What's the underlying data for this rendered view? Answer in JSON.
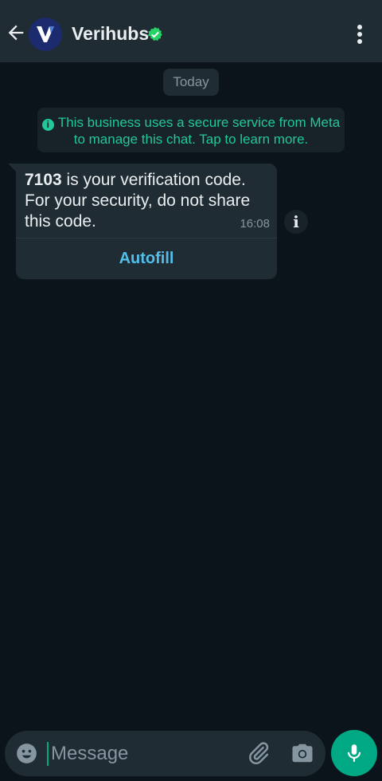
{
  "header": {
    "title": "Verihubs",
    "verified": true
  },
  "chat": {
    "date_chip": "Today",
    "notice": "This business uses a secure service from Meta to manage this chat. Tap to learn more.",
    "message": {
      "code": "7103",
      "text": " is your verification code. For your security, do not share this code.",
      "time": "16:08",
      "action_label": "Autofill"
    }
  },
  "composer": {
    "placeholder": "Message"
  },
  "colors": {
    "header_bg": "#1f2c34",
    "chat_bg": "#0b141a",
    "accent_green": "#00a884",
    "notice_text": "#20c997",
    "link_blue": "#53bdeb"
  },
  "icons": [
    "back-arrow-icon",
    "verified-badge-icon",
    "more-vert-icon",
    "info-icon",
    "emoji-icon",
    "attach-icon",
    "camera-icon",
    "mic-icon"
  ]
}
